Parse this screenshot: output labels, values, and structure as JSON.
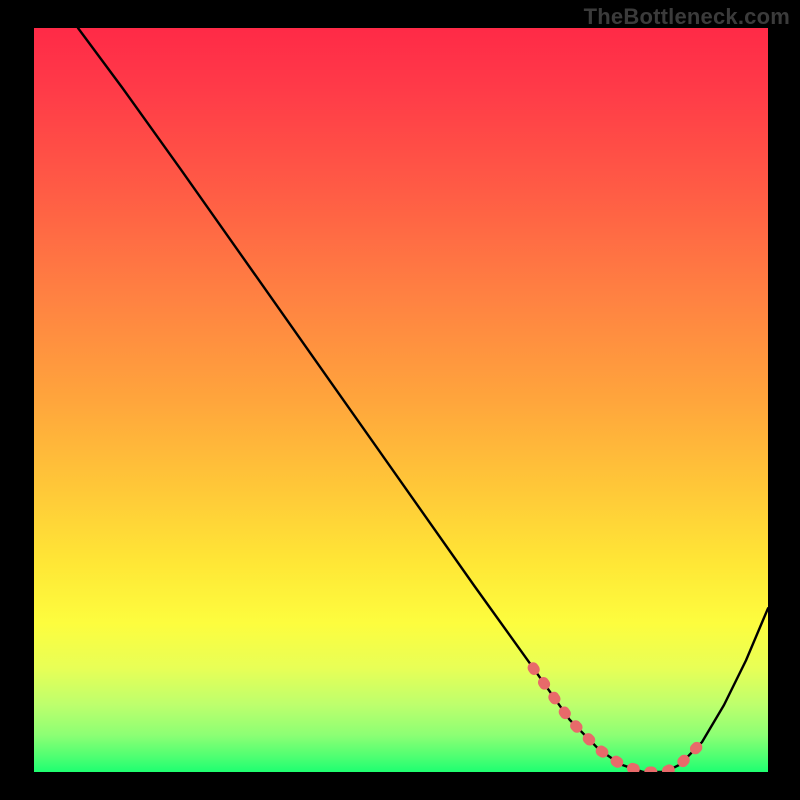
{
  "watermark": "TheBottleneck.com",
  "chart_data": {
    "type": "line",
    "title": "",
    "xlabel": "",
    "ylabel": "",
    "xlim": [
      0,
      100
    ],
    "ylim": [
      0,
      100
    ],
    "grid": false,
    "background_gradient": [
      "#ff2a47",
      "#ffa53c",
      "#ffe736",
      "#1eff71"
    ],
    "series": [
      {
        "name": "bottleneck-curve",
        "color": "#000000",
        "x": [
          6,
          12,
          20,
          30,
          40,
          50,
          60,
          68,
          73,
          77,
          80,
          83,
          86,
          88,
          91,
          94,
          97,
          100
        ],
        "y": [
          100,
          92,
          81,
          67,
          53,
          39,
          25,
          14,
          7,
          3,
          1,
          0,
          0,
          1,
          4,
          9,
          15,
          22
        ]
      }
    ],
    "highlight": {
      "name": "optimal-zone",
      "color": "#e86a6a",
      "style": "dotted",
      "x": [
        68,
        73,
        77,
        80,
        83,
        86,
        88,
        91
      ],
      "y": [
        14,
        7,
        3,
        1,
        0,
        0,
        1,
        4
      ]
    }
  }
}
